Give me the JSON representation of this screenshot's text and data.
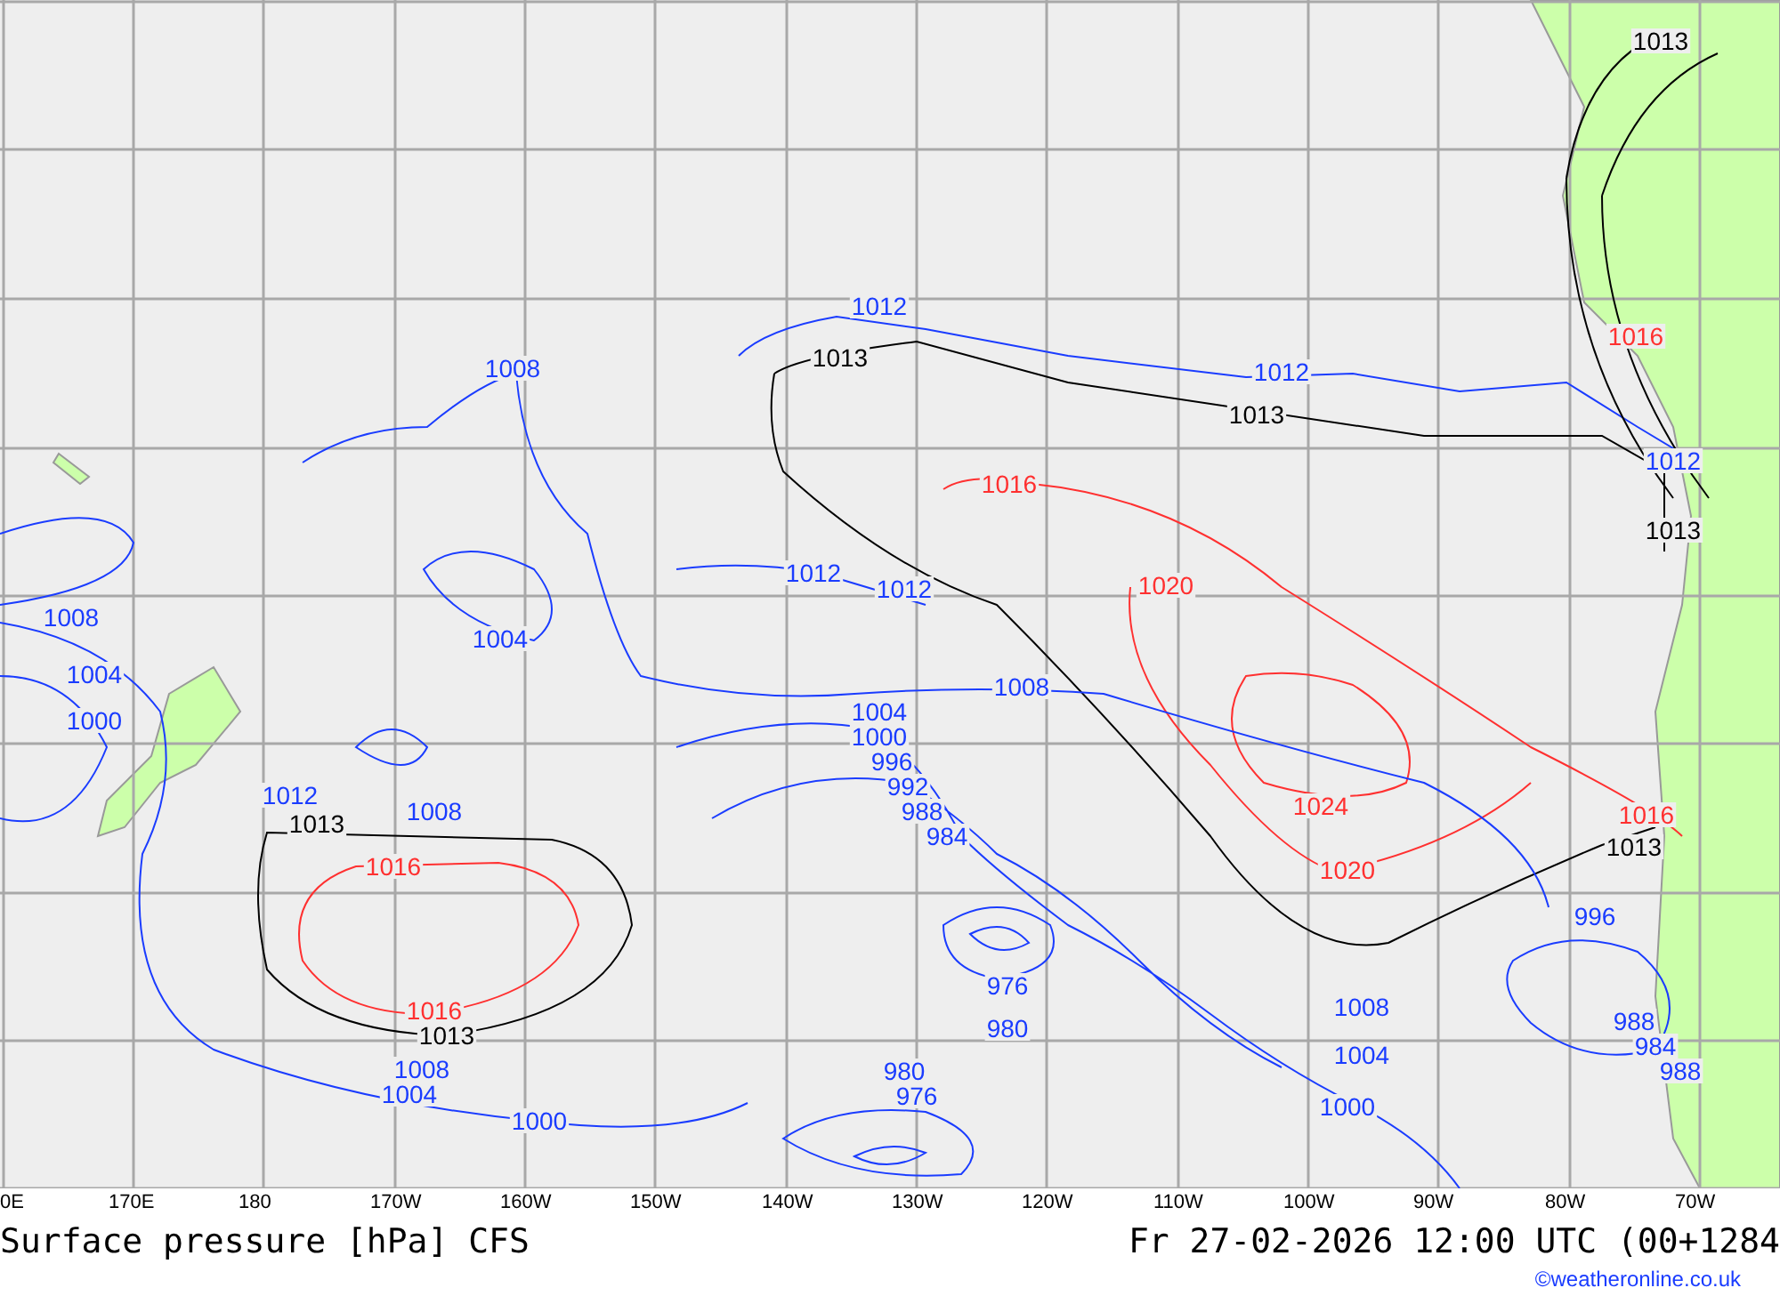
{
  "map": {
    "labels": [
      {
        "text": "1013",
        "color": "#000000"
      },
      {
        "text": "1012",
        "color": "#1a3cff"
      },
      {
        "text": "1016",
        "color": "#ff3030"
      },
      {
        "text": "1008",
        "color": "#1a3cff"
      },
      {
        "text": "1013",
        "color": "#000000"
      },
      {
        "text": "1012",
        "color": "#1a3cff"
      },
      {
        "text": "1013",
        "color": "#000000"
      },
      {
        "text": "1012",
        "color": "#1a3cff"
      },
      {
        "text": "1016",
        "color": "#ff3030"
      },
      {
        "text": "1013",
        "color": "#000000"
      },
      {
        "text": "1012",
        "color": "#1a3cff"
      },
      {
        "text": "1012",
        "color": "#1a3cff"
      },
      {
        "text": "1020",
        "color": "#ff3030"
      },
      {
        "text": "1008",
        "color": "#1a3cff"
      },
      {
        "text": "1004",
        "color": "#1a3cff"
      },
      {
        "text": "1004",
        "color": "#1a3cff"
      },
      {
        "text": "1008",
        "color": "#1a3cff"
      },
      {
        "text": "1000",
        "color": "#1a3cff"
      },
      {
        "text": "1004",
        "color": "#1a3cff"
      },
      {
        "text": "1000",
        "color": "#1a3cff"
      },
      {
        "text": "996",
        "color": "#1a3cff"
      },
      {
        "text": "1012",
        "color": "#1a3cff"
      },
      {
        "text": "1008",
        "color": "#1a3cff"
      },
      {
        "text": "992",
        "color": "#1a3cff"
      },
      {
        "text": "988",
        "color": "#1a3cff"
      },
      {
        "text": "1024",
        "color": "#ff3030"
      },
      {
        "text": "1013",
        "color": "#000000"
      },
      {
        "text": "984",
        "color": "#1a3cff"
      },
      {
        "text": "1016",
        "color": "#ff3030"
      },
      {
        "text": "1013",
        "color": "#000000"
      },
      {
        "text": "1016",
        "color": "#ff3030"
      },
      {
        "text": "1020",
        "color": "#ff3030"
      },
      {
        "text": "996",
        "color": "#1a3cff"
      },
      {
        "text": "976",
        "color": "#1a3cff"
      },
      {
        "text": "1016",
        "color": "#ff3030"
      },
      {
        "text": "1008",
        "color": "#1a3cff"
      },
      {
        "text": "1013",
        "color": "#000000"
      },
      {
        "text": "980",
        "color": "#1a3cff"
      },
      {
        "text": "988",
        "color": "#1a3cff"
      },
      {
        "text": "1004",
        "color": "#1a3cff"
      },
      {
        "text": "984",
        "color": "#1a3cff"
      },
      {
        "text": "1008",
        "color": "#1a3cff"
      },
      {
        "text": "980",
        "color": "#1a3cff"
      },
      {
        "text": "988",
        "color": "#1a3cff"
      },
      {
        "text": "1004",
        "color": "#1a3cff"
      },
      {
        "text": "976",
        "color": "#1a3cff"
      },
      {
        "text": "1000",
        "color": "#1a3cff"
      },
      {
        "text": "1000",
        "color": "#1a3cff"
      }
    ]
  },
  "axis": [
    "0E",
    "170E",
    "180",
    "170W",
    "160W",
    "150W",
    "140W",
    "130W",
    "120W",
    "110W",
    "100W",
    "90W",
    "80W",
    "70W"
  ],
  "title": "Surface pressure [hPa] CFS",
  "valid_time": "Fr 27-02-2026 12:00 UTC (00+1284",
  "credit": "©weatheronline.co.uk"
}
